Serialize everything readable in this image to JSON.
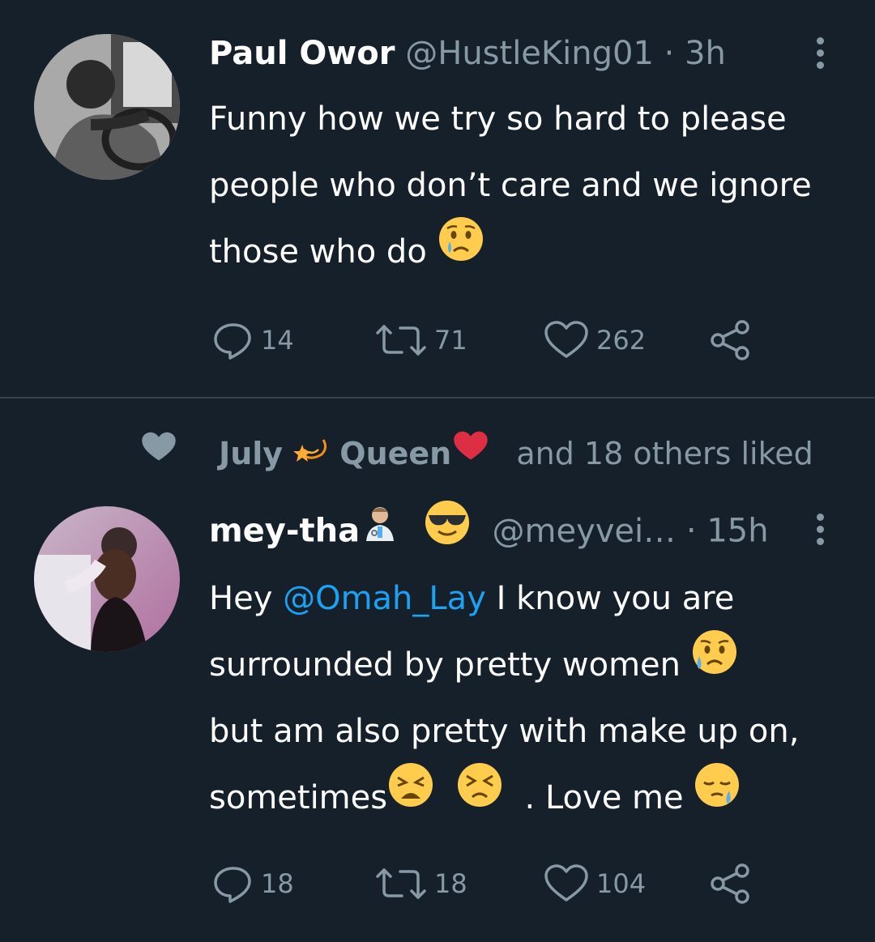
{
  "colors": {
    "background": "#15202b",
    "text_primary": "#ffffff",
    "text_secondary": "#8899a6",
    "link": "#1da1f2",
    "divider": "#38444d"
  },
  "tweet1": {
    "display_name": "Paul Owor",
    "handle": "@HustleKing01",
    "separator": "·",
    "time": "3h",
    "text_line1": "Funny how we try so hard to please",
    "text_line2": "people who don’t care and we ignore",
    "text_line3": "those who do",
    "emoji": "crying-face",
    "reply_count": "14",
    "retweet_count": "71",
    "like_count": "262"
  },
  "tweet2": {
    "liked_by": {
      "name1": "July",
      "emoji1": "dizzy-star",
      "name2": "Queen",
      "emoji2": "red-heart",
      "suffix": "and 18 others liked"
    },
    "display_name": "mey-tha",
    "name_emojis": [
      "health-worker",
      "sunglasses-face"
    ],
    "handle": "@meyvei…",
    "separator": "·",
    "time": "15h",
    "text_prefix": "Hey ",
    "mention": "@Omah_Lay",
    "text_line1_rest": " I know you are",
    "text_line2": "surrounded by pretty women",
    "text_line3": "but am also pretty with make up on,",
    "text_line4_a": "sometimes",
    "text_line4_b": ". Love me",
    "reply_count": "18",
    "retweet_count": "18",
    "like_count": "104"
  }
}
